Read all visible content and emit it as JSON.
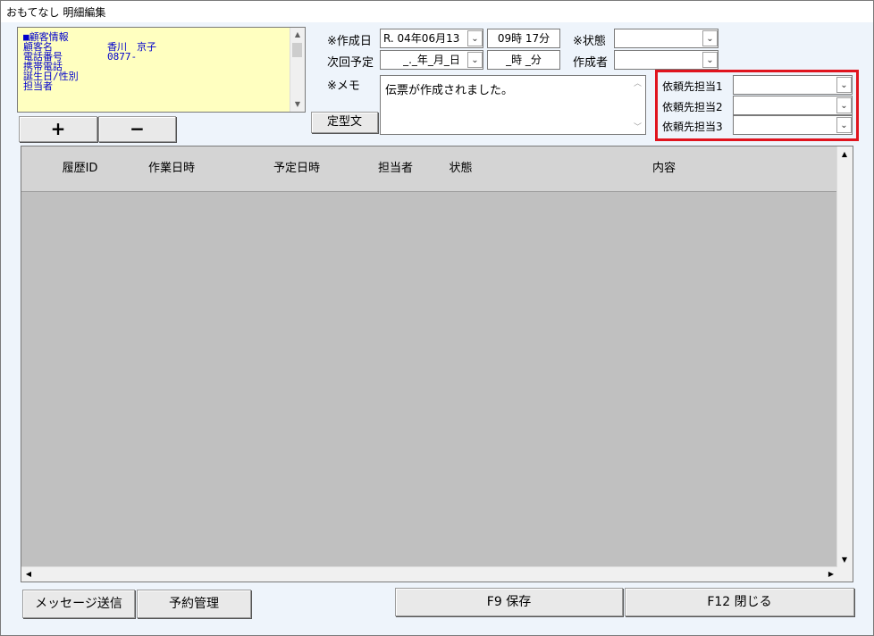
{
  "window": {
    "title": "おもてなし 明細編集"
  },
  "customer": {
    "header": "■顧客情報",
    "name_label": "顧客名",
    "name_value": "香川　京子",
    "phone_label": "電話番号",
    "phone_value": "0877-",
    "mobile_label": "携帯電話",
    "birth_label": "誕生日/性別",
    "staff_label": "担当者"
  },
  "buttons": {
    "plus": "+",
    "minus": "−",
    "template": "定型文",
    "message": "メッセージ送信",
    "reservation": "予約管理",
    "save": "F9 保存",
    "close": "F12 閉じる"
  },
  "form": {
    "created_label": "※作成日",
    "created_date": "R. 04年06月13",
    "created_time": "09時 17分",
    "status_label": "※状態",
    "status_value": "",
    "next_label": "次回予定",
    "next_date": "_._年_月_日",
    "next_time": "_時 _分",
    "author_label": "作成者",
    "author_value": "",
    "memo_label": "※メモ",
    "memo_value": "伝票が作成されました。",
    "request1_label": "依頼先担当1",
    "request2_label": "依頼先担当2",
    "request3_label": "依頼先担当3",
    "request1_value": "",
    "request2_value": "",
    "request3_value": ""
  },
  "grid": {
    "columns": [
      "",
      "履歴ID",
      "作業日時",
      "予定日時",
      "担当者",
      "状態",
      "内容"
    ],
    "rows": []
  },
  "colors": {
    "highlight_border": "#e0141e",
    "customer_bg": "#ffffc0",
    "customer_text": "#0000cc"
  }
}
